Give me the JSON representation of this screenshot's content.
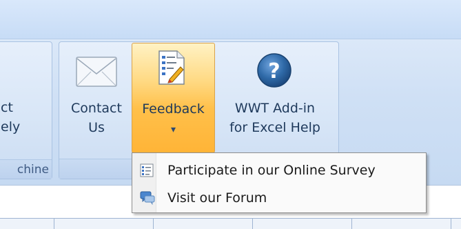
{
  "ribbon": {
    "left_group": {
      "line1": "ct",
      "line2": "ely",
      "group_label": "chine"
    },
    "buttons": {
      "contact": {
        "line1": "Contact",
        "line2": "Us",
        "icon": "envelope-icon"
      },
      "feedback": {
        "line1": "Feedback",
        "icon": "feedback-form-icon",
        "dropdown_arrow": "▾"
      },
      "help": {
        "line1": "WWT Add-in",
        "line2": "for Excel Help",
        "icon": "help-icon",
        "glyph": "?"
      }
    }
  },
  "dropdown_menu": {
    "items": [
      {
        "label": "Participate in our Online Survey",
        "icon": "survey-list-icon"
      },
      {
        "label": "Visit our Forum",
        "icon": "forum-chat-icon"
      }
    ]
  },
  "colors": {
    "accent_feedback": "#ffc04a",
    "label_text": "#1e395b",
    "help_icon_blue": "#2f6aa8"
  }
}
